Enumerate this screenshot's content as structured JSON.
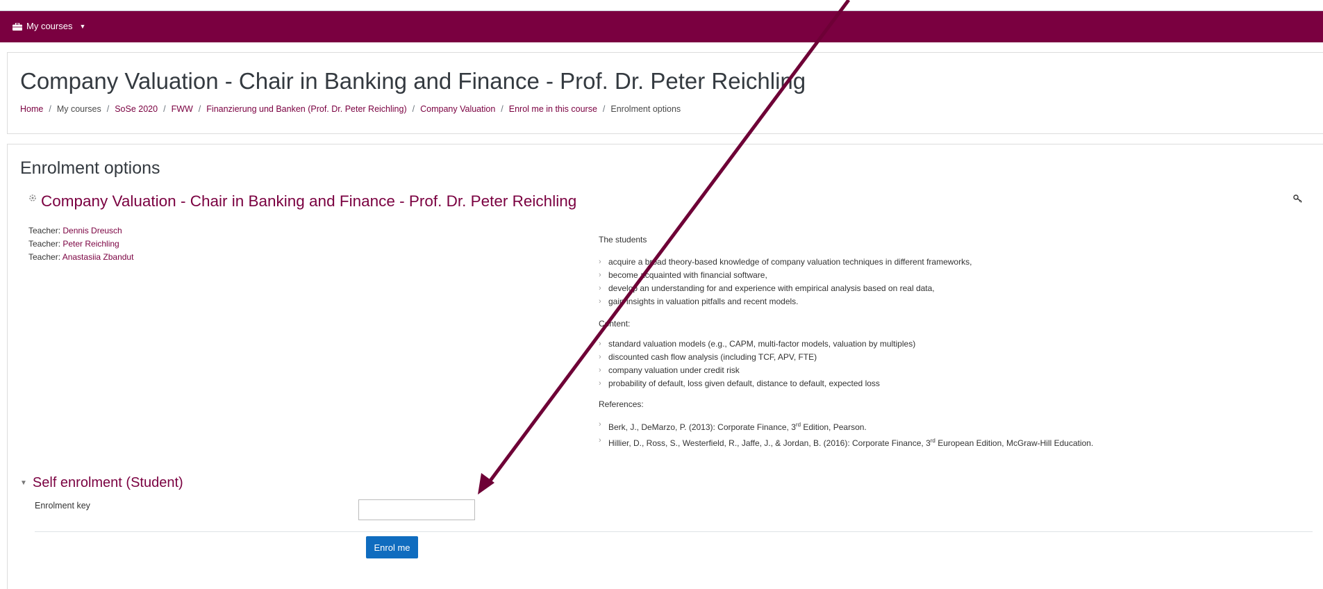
{
  "colors": {
    "brand": "#7a0040",
    "button": "#0f6cbf",
    "arrow": "#6e0036"
  },
  "navbar": {
    "menu_label": "My courses",
    "menu_icon": "briefcase-icon",
    "caret_icon": "caret-down-icon"
  },
  "header": {
    "title": "Company Valuation - Chair in Banking and Finance - Prof. Dr. Peter Reichling",
    "breadcrumb": [
      {
        "label": "Home",
        "link": true
      },
      {
        "label": "My courses",
        "link": false
      },
      {
        "label": "SoSe 2020",
        "link": true
      },
      {
        "label": "FWW",
        "link": true
      },
      {
        "label": "Finanzierung und Banken (Prof. Dr. Peter Reichling)",
        "link": true
      },
      {
        "label": "Company Valuation",
        "link": true
      },
      {
        "label": "Enrol me in this course",
        "link": true
      },
      {
        "label": "Enrolment options",
        "link": false
      }
    ]
  },
  "main": {
    "section_title": "Enrolment options",
    "course_name": "Company Valuation - Chair in Banking and Finance - Prof. Dr. Peter Reichling",
    "teachers": [
      {
        "role": "Teacher: ",
        "name": "Dennis Dreusch"
      },
      {
        "role": "Teacher: ",
        "name": "Peter Reichling"
      },
      {
        "role": "Teacher: ",
        "name": "Anastasiia Zbandut"
      }
    ],
    "summary": {
      "intro": "The students",
      "outcomes": [
        "acquire a broad theory-based knowledge of company valuation techniques in different frameworks,",
        "become acquainted with financial software,",
        "develop an understanding for and experience with empirical analysis based on real data,",
        "gain insights in valuation pitfalls and recent models."
      ],
      "content_heading": "Content:",
      "content": [
        "standard valuation models (e.g., CAPM, multi-factor models, valuation by multiples)",
        "discounted cash flow analysis (including TCF, APV, FTE)",
        "company valuation under credit risk",
        "probability of default, loss given default, distance to default, expected loss"
      ],
      "references_heading": "References:",
      "ref1_pre": "Berk, J., DeMarzo, P. (2013): Corporate Finance, 3",
      "ref1_sup": "rd",
      "ref1_post": " Edition, Pearson.",
      "ref2_pre": "Hillier, D., Ross, S., Westerfield, R., Jaffe, J., & Jordan, B. (2016): Corporate Finance, 3",
      "ref2_sup": "rd",
      "ref2_post": " European Edition, McGraw-Hill Education."
    },
    "self_enrolment": {
      "title": "Self enrolment (Student)",
      "key_label": "Enrolment key",
      "key_value": "",
      "button_label": "Enrol me"
    }
  }
}
